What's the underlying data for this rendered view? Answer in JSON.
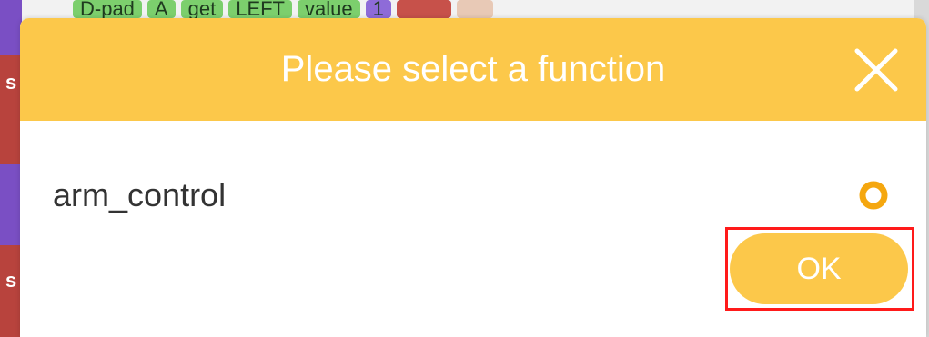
{
  "background": {
    "block_row": [
      "D-pad",
      "A",
      "get",
      "LEFT",
      "value",
      "1"
    ],
    "side_letters": [
      "s",
      "s"
    ]
  },
  "dialog": {
    "title": "Please select a function",
    "close_icon": "close-icon",
    "options": [
      {
        "label": "arm_control",
        "selected": true
      }
    ],
    "ok_label": "OK"
  },
  "colors": {
    "accent": "#fcc84a",
    "title_text": "#ffffff",
    "option_text": "#333333",
    "radio": "#f5a70f",
    "highlight": "#ff1a1a"
  }
}
